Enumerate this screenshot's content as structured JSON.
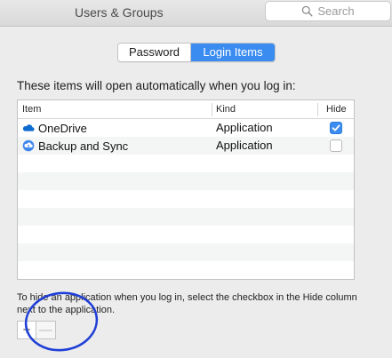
{
  "window": {
    "title": "Users & Groups",
    "search_placeholder": "Search"
  },
  "tabs": [
    {
      "label": "Password",
      "selected": false
    },
    {
      "label": "Login Items",
      "selected": true
    }
  ],
  "intro_text": "These items will open automatically when you log in:",
  "table": {
    "columns": [
      "Item",
      "Kind",
      "Hide"
    ],
    "rows": [
      {
        "name": "OneDrive",
        "kind": "Application",
        "hide": true,
        "icon": "onedrive-icon"
      },
      {
        "name": "Backup and Sync",
        "kind": "Application",
        "hide": false,
        "icon": "backup-sync-icon"
      }
    ]
  },
  "help_text": "To hide an application when you log in, select the checkbox in the Hide column next to the application.",
  "buttons": {
    "add_label": "+",
    "remove_label": "—"
  },
  "colors": {
    "accent": "#3b8cf0",
    "annotation": "#1f3fd6"
  }
}
